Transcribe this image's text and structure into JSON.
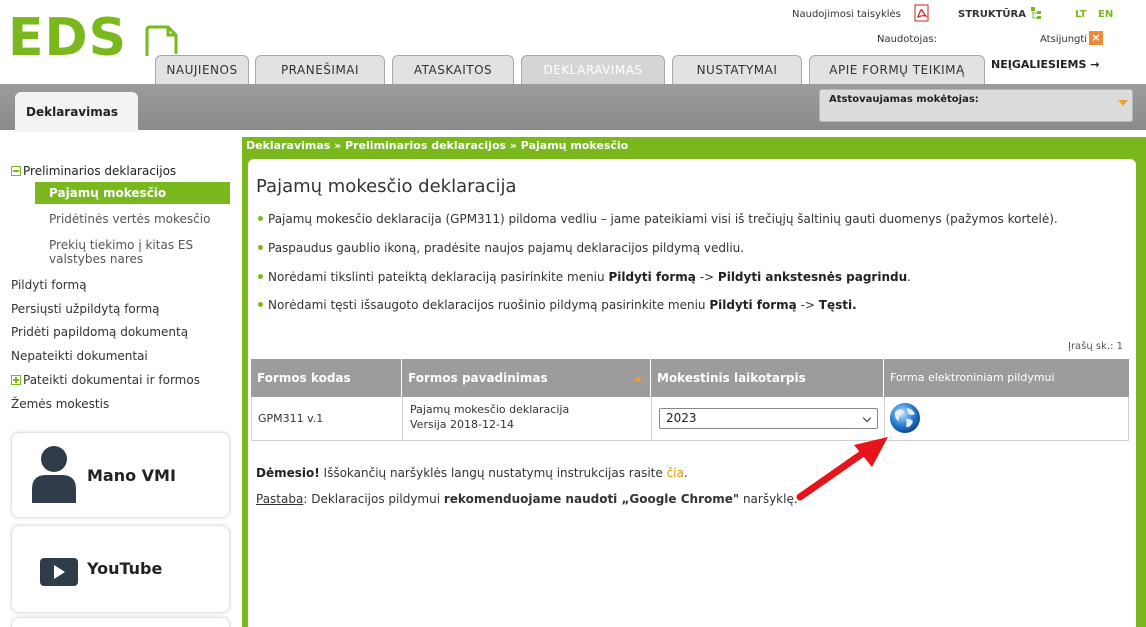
{
  "header": {
    "logo_text": "EDS",
    "rules_link": "Naudojimosi taisyklės",
    "structure_link": "STRUKTŪRA",
    "lang_lt": "LT",
    "lang_en": "EN",
    "user_label": "Naudotojas:",
    "logout_label": "Atsijungti",
    "tabs": [
      {
        "label": "NAUJIENOS"
      },
      {
        "label": "PRANEŠIMAI"
      },
      {
        "label": "ATASKAITOS"
      },
      {
        "label": "DEKLARAVIMAS",
        "active": true
      },
      {
        "label": "NUSTATYMAI"
      },
      {
        "label": "APIE FORMŲ TEIKIMĄ"
      }
    ],
    "accessibility_link": "NEĮGALIESIEMS →"
  },
  "subheader": {
    "left_tab": "Deklaravimas",
    "payer_label": "Atstovaujamas mokėtojas:"
  },
  "sidebar": {
    "preliminary": "Preliminarios deklaracijos",
    "pajamu": "Pajamų mokesčio",
    "pvm": "Pridėtinės vertės mokesčio",
    "prekiu_line1": "Prekių tiekimo į kitas ES",
    "prekiu_line2": "valstybes nares",
    "pildyti": "Pildyti formą",
    "persiusti": "Persiųsti užpildytą formą",
    "prideti": "Pridėti papildomą dokumentą",
    "nepateikti": "Nepateikti dokumentai",
    "pateikti": "Pateikti dokumentai ir formos",
    "zemes": "Žemės mokestis",
    "card_vmi": "Mano VMI",
    "card_youtube": "YouTube"
  },
  "main": {
    "breadcrumb": "Deklaravimas » Preliminarios deklaracijos » Pajamų mokesčio",
    "title": "Pajamų mokesčio deklaracija",
    "bullet1": "Pajamų mokesčio deklaracija (GPM311) pildoma vedliu – jame pateikiami visi iš trečiųjų šaltinių gauti duomenys (pažymos kortelė).",
    "bullet2": "Paspaudus gaublio ikoną, pradėsite naujos pajamų deklaracijos pildymą vedliu.",
    "bullet3_pre": "Norėdami tikslinti pateiktą deklaraciją pasirinkite meniu ",
    "bullet3_b1": "Pildyti formą",
    "bullet3_mid": " -> ",
    "bullet3_b2": "Pildyti ankstesnės pagrindu",
    "bullet3_end": ".",
    "bullet4_pre": "Norėdami tęsti išsaugoto deklaracijos ruošinio pildymą pasirinkite meniu ",
    "bullet4_b1": "Pildyti formą",
    "bullet4_mid": " -> ",
    "bullet4_b2": "Tęsti.",
    "record_count": "Įrašų sk.: 1",
    "table": {
      "headers": [
        "Formos kodas",
        "Formos pavadinimas",
        "Mokestinis laikotarpis",
        "Forma elektroniniam pildymui"
      ],
      "row": {
        "code": "GPM311 v.1",
        "name_line1": "Pajamų mokesčio deklaracija",
        "name_line2": "Versija 2018-12-14",
        "period": "2023"
      }
    },
    "notice_bold": "Dėmesio!",
    "notice_text": " Iššokančių naršyklės langų nustatymų instrukcijas rasite ",
    "notice_link": "čia",
    "notice_end": ".",
    "note_label": "Pastaba",
    "note_text": ": Deklaracijos pildymui ",
    "note_bold": "rekomenduojame naudoti „Google Chrome\"",
    "note_end": " naršyklę."
  },
  "colors": {
    "brand_green": "#7ab81e",
    "header_grey": "#9c9c9c",
    "accent_orange": "#f0a030",
    "arrow_red": "#e8141c"
  }
}
